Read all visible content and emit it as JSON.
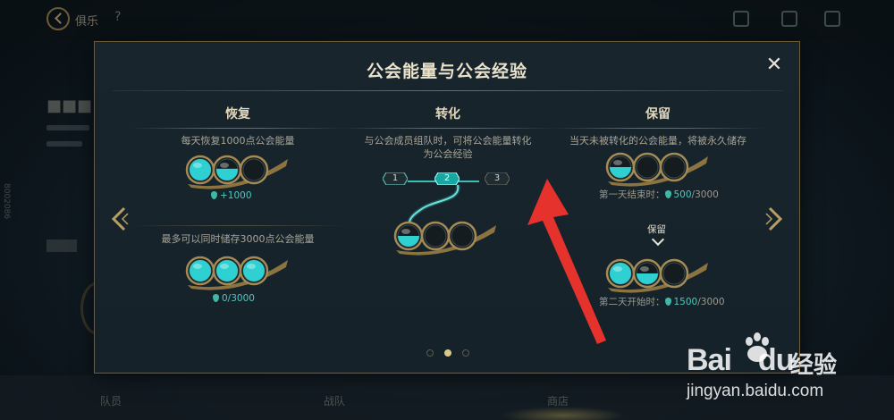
{
  "background": {
    "top_title": "俱乐",
    "left_vertical": "8002086",
    "bottom_tabs": [
      "队员",
      "战队",
      "商店"
    ]
  },
  "modal": {
    "title": "公会能量与公会经验",
    "close_glyph": "✕",
    "columns": {
      "recover": {
        "heading": "恢复",
        "desc_top": "每天恢复1000点公会能量",
        "stat_top": "+1000",
        "desc_bottom": "最多可以同时储存3000点公会能量",
        "stat_bottom": "0/3000"
      },
      "convert": {
        "heading": "转化",
        "desc": "与公会成员组队时，可将公会能量转化为公会经验",
        "steps": [
          "1",
          "2",
          "3"
        ],
        "active_step": 2
      },
      "keep": {
        "heading": "保留",
        "desc": "当天未被转化的公会能量，将被永久储存",
        "label_day1": "第一天结束时：",
        "stat_day1_value": "500",
        "stat_day1_total": "/3000",
        "keep_label": "保留",
        "label_day2": "第二天开始时：",
        "stat_day2_value": "1500",
        "stat_day2_total": "/3000"
      }
    },
    "pagination": {
      "pages": 3,
      "current": 2
    }
  },
  "orb_rows": {
    "recover_top": [
      1,
      0.55,
      0
    ],
    "recover_bottom": [
      1,
      1,
      1
    ],
    "convert": [
      0.5,
      0,
      0
    ],
    "keep_day1": [
      0.5,
      0,
      0
    ],
    "keep_day2": [
      1,
      0.5,
      0
    ]
  },
  "watermark": {
    "logo_text": "Bai",
    "logo_text2": "du",
    "cn": "经验",
    "url": "jingyan.baidu.com"
  },
  "colors": {
    "accent_gold": "#7a6a44",
    "energy_teal": "#4ec9c0",
    "annotation_red": "#e5322d"
  }
}
